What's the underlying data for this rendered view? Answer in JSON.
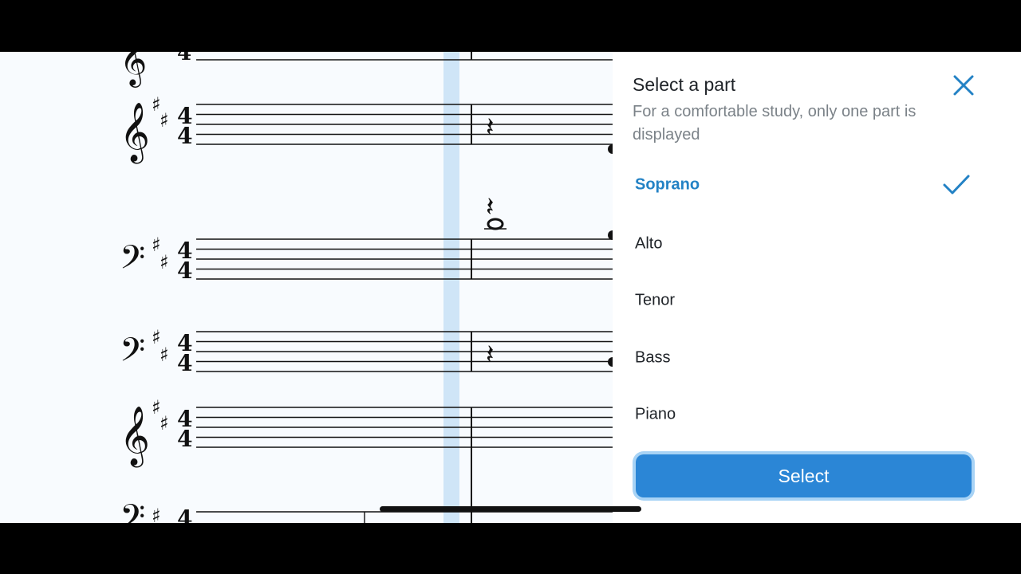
{
  "panel": {
    "title": "Select a part",
    "subtitle": "For a comfortable study, only one part is displayed",
    "close_icon": "close-icon",
    "parts": [
      {
        "label": "Soprano",
        "selected": true
      },
      {
        "label": "Alto",
        "selected": false
      },
      {
        "label": "Tenor",
        "selected": false
      },
      {
        "label": "Bass",
        "selected": false
      },
      {
        "label": "Piano",
        "selected": false
      }
    ],
    "select_label": "Select",
    "accent_color": "#2382c5",
    "button_color": "#2b86d6"
  },
  "score": {
    "time_signature": "4/4",
    "key_signature": "D major (2 sharps)",
    "staves": [
      {
        "clef": "treble"
      },
      {
        "clef": "treble"
      },
      {
        "clef": "bass"
      },
      {
        "clef": "bass"
      },
      {
        "clef": "treble"
      },
      {
        "clef": "bass"
      }
    ]
  }
}
